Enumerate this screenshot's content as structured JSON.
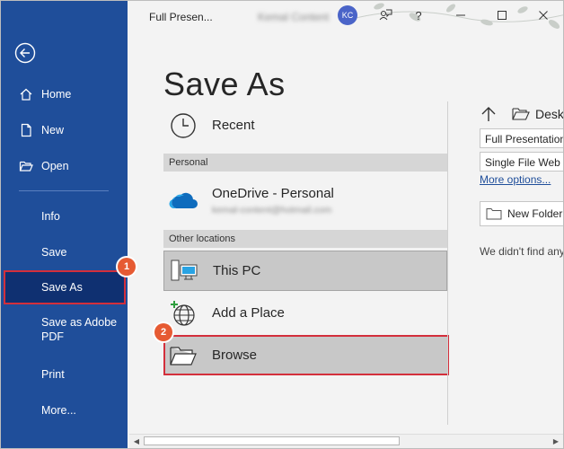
{
  "titlebar": {
    "doc_title": "Full Presen...",
    "user_name": "Kemal Content",
    "avatar_initials": "KC",
    "buttons": [
      "feedback-icon",
      "help-icon",
      "minimize-icon",
      "maximize-icon",
      "close-icon"
    ],
    "help_glyph": "?"
  },
  "nav": {
    "items": [
      {
        "label": "Home",
        "icon": "home-icon"
      },
      {
        "label": "New",
        "icon": "new-document-icon"
      },
      {
        "label": "Open",
        "icon": "open-folder-icon"
      },
      {
        "label": "Info"
      },
      {
        "label": "Save"
      },
      {
        "label": "Save As",
        "selected": true
      },
      {
        "label": "Save as Adobe PDF"
      },
      {
        "label": "Print"
      },
      {
        "label": "More..."
      }
    ]
  },
  "main": {
    "title": "Save As",
    "locations": {
      "recent_label": "Recent",
      "personal_header": "Personal",
      "onedrive_label": "OneDrive - Personal",
      "onedrive_email": "kemal-content@hotmail.com",
      "other_header": "Other locations",
      "this_pc_label": "This PC",
      "add_place_label": "Add a Place",
      "browse_label": "Browse"
    },
    "right": {
      "path_label": "Desktop",
      "filename_value": "Full Presentation",
      "filetype_value": "Single File Web Page",
      "more_options": "More options...",
      "new_folder": "New Folder",
      "empty_message": "We didn't find anything"
    }
  },
  "callouts": [
    "1",
    "2"
  ],
  "colors": {
    "nav_bg": "#1f4e9a",
    "nav_selected": "#0f3071",
    "highlight_border": "#d32f3b",
    "callout": "#e65a32",
    "onedrive_blue": "#0f6cbd"
  }
}
